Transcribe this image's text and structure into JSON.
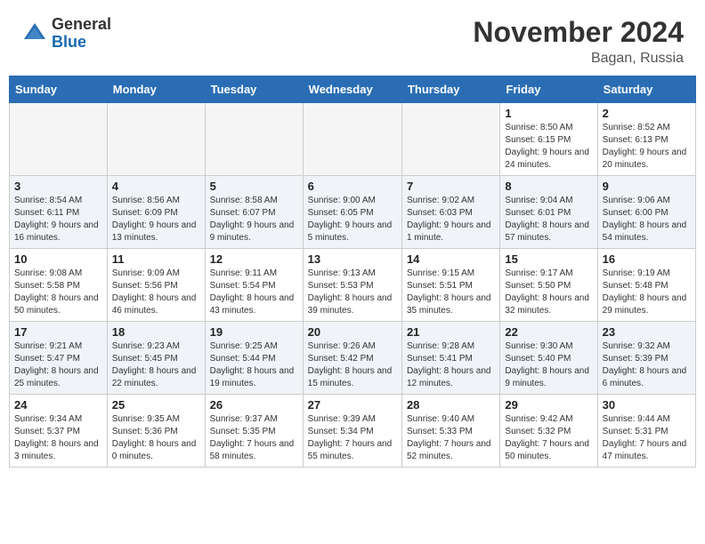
{
  "header": {
    "logo_general": "General",
    "logo_blue": "Blue",
    "month_title": "November 2024",
    "location": "Bagan, Russia"
  },
  "weekdays": [
    "Sunday",
    "Monday",
    "Tuesday",
    "Wednesday",
    "Thursday",
    "Friday",
    "Saturday"
  ],
  "weeks": [
    [
      {
        "day": "",
        "info": ""
      },
      {
        "day": "",
        "info": ""
      },
      {
        "day": "",
        "info": ""
      },
      {
        "day": "",
        "info": ""
      },
      {
        "day": "",
        "info": ""
      },
      {
        "day": "1",
        "info": "Sunrise: 8:50 AM\nSunset: 6:15 PM\nDaylight: 9 hours and 24 minutes."
      },
      {
        "day": "2",
        "info": "Sunrise: 8:52 AM\nSunset: 6:13 PM\nDaylight: 9 hours and 20 minutes."
      }
    ],
    [
      {
        "day": "3",
        "info": "Sunrise: 8:54 AM\nSunset: 6:11 PM\nDaylight: 9 hours and 16 minutes."
      },
      {
        "day": "4",
        "info": "Sunrise: 8:56 AM\nSunset: 6:09 PM\nDaylight: 9 hours and 13 minutes."
      },
      {
        "day": "5",
        "info": "Sunrise: 8:58 AM\nSunset: 6:07 PM\nDaylight: 9 hours and 9 minutes."
      },
      {
        "day": "6",
        "info": "Sunrise: 9:00 AM\nSunset: 6:05 PM\nDaylight: 9 hours and 5 minutes."
      },
      {
        "day": "7",
        "info": "Sunrise: 9:02 AM\nSunset: 6:03 PM\nDaylight: 9 hours and 1 minute."
      },
      {
        "day": "8",
        "info": "Sunrise: 9:04 AM\nSunset: 6:01 PM\nDaylight: 8 hours and 57 minutes."
      },
      {
        "day": "9",
        "info": "Sunrise: 9:06 AM\nSunset: 6:00 PM\nDaylight: 8 hours and 54 minutes."
      }
    ],
    [
      {
        "day": "10",
        "info": "Sunrise: 9:08 AM\nSunset: 5:58 PM\nDaylight: 8 hours and 50 minutes."
      },
      {
        "day": "11",
        "info": "Sunrise: 9:09 AM\nSunset: 5:56 PM\nDaylight: 8 hours and 46 minutes."
      },
      {
        "day": "12",
        "info": "Sunrise: 9:11 AM\nSunset: 5:54 PM\nDaylight: 8 hours and 43 minutes."
      },
      {
        "day": "13",
        "info": "Sunrise: 9:13 AM\nSunset: 5:53 PM\nDaylight: 8 hours and 39 minutes."
      },
      {
        "day": "14",
        "info": "Sunrise: 9:15 AM\nSunset: 5:51 PM\nDaylight: 8 hours and 35 minutes."
      },
      {
        "day": "15",
        "info": "Sunrise: 9:17 AM\nSunset: 5:50 PM\nDaylight: 8 hours and 32 minutes."
      },
      {
        "day": "16",
        "info": "Sunrise: 9:19 AM\nSunset: 5:48 PM\nDaylight: 8 hours and 29 minutes."
      }
    ],
    [
      {
        "day": "17",
        "info": "Sunrise: 9:21 AM\nSunset: 5:47 PM\nDaylight: 8 hours and 25 minutes."
      },
      {
        "day": "18",
        "info": "Sunrise: 9:23 AM\nSunset: 5:45 PM\nDaylight: 8 hours and 22 minutes."
      },
      {
        "day": "19",
        "info": "Sunrise: 9:25 AM\nSunset: 5:44 PM\nDaylight: 8 hours and 19 minutes."
      },
      {
        "day": "20",
        "info": "Sunrise: 9:26 AM\nSunset: 5:42 PM\nDaylight: 8 hours and 15 minutes."
      },
      {
        "day": "21",
        "info": "Sunrise: 9:28 AM\nSunset: 5:41 PM\nDaylight: 8 hours and 12 minutes."
      },
      {
        "day": "22",
        "info": "Sunrise: 9:30 AM\nSunset: 5:40 PM\nDaylight: 8 hours and 9 minutes."
      },
      {
        "day": "23",
        "info": "Sunrise: 9:32 AM\nSunset: 5:39 PM\nDaylight: 8 hours and 6 minutes."
      }
    ],
    [
      {
        "day": "24",
        "info": "Sunrise: 9:34 AM\nSunset: 5:37 PM\nDaylight: 8 hours and 3 minutes."
      },
      {
        "day": "25",
        "info": "Sunrise: 9:35 AM\nSunset: 5:36 PM\nDaylight: 8 hours and 0 minutes."
      },
      {
        "day": "26",
        "info": "Sunrise: 9:37 AM\nSunset: 5:35 PM\nDaylight: 7 hours and 58 minutes."
      },
      {
        "day": "27",
        "info": "Sunrise: 9:39 AM\nSunset: 5:34 PM\nDaylight: 7 hours and 55 minutes."
      },
      {
        "day": "28",
        "info": "Sunrise: 9:40 AM\nSunset: 5:33 PM\nDaylight: 7 hours and 52 minutes."
      },
      {
        "day": "29",
        "info": "Sunrise: 9:42 AM\nSunset: 5:32 PM\nDaylight: 7 hours and 50 minutes."
      },
      {
        "day": "30",
        "info": "Sunrise: 9:44 AM\nSunset: 5:31 PM\nDaylight: 7 hours and 47 minutes."
      }
    ]
  ]
}
